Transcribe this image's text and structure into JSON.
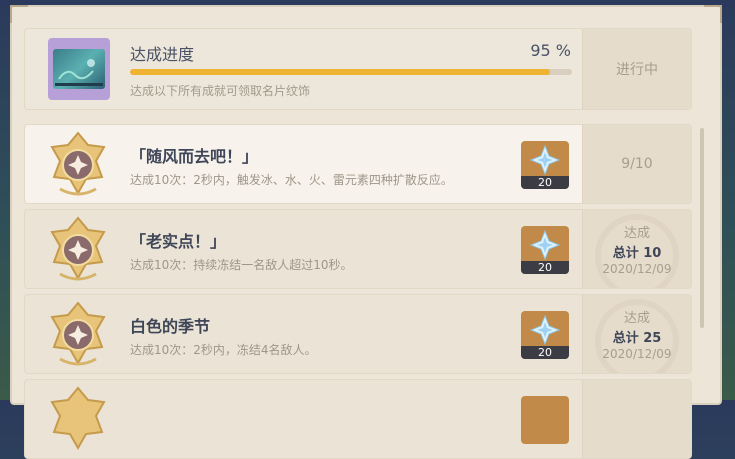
{
  "header": {
    "title": "达成进度",
    "percent_text": "95 %",
    "progress": 0.95,
    "subtitle": "达成以下所有成就可领取名片纹饰",
    "status": "进行中"
  },
  "achievements": [
    {
      "title": "「随风而去吧！」",
      "desc": "达成10次：2秒内，触发冰、水、火、雷元素四种扩散反应。",
      "reward_qty": "20",
      "progress": "9/10"
    },
    {
      "title": "「老实点！」",
      "desc": "达成10次：持续冻结一名敌人超过10秒。",
      "reward_qty": "20",
      "done_label": "达成",
      "total": "总计 10",
      "date": "2020/12/09"
    },
    {
      "title": "白色的季节",
      "desc": "达成10次：2秒内，冻结4名敌人。",
      "reward_qty": "20",
      "done_label": "达成",
      "total": "总计 25",
      "date": "2020/12/09"
    },
    {
      "title": "",
      "desc": "",
      "reward_qty": ""
    }
  ],
  "colors": {
    "panel": "#ece5d8",
    "progress_fill": "#f0b232",
    "reward_bg": "#c28a48"
  },
  "icons": {
    "namecard": "namecard-icon",
    "medal": "achievement-medal-icon",
    "reward": "primogem-icon"
  }
}
